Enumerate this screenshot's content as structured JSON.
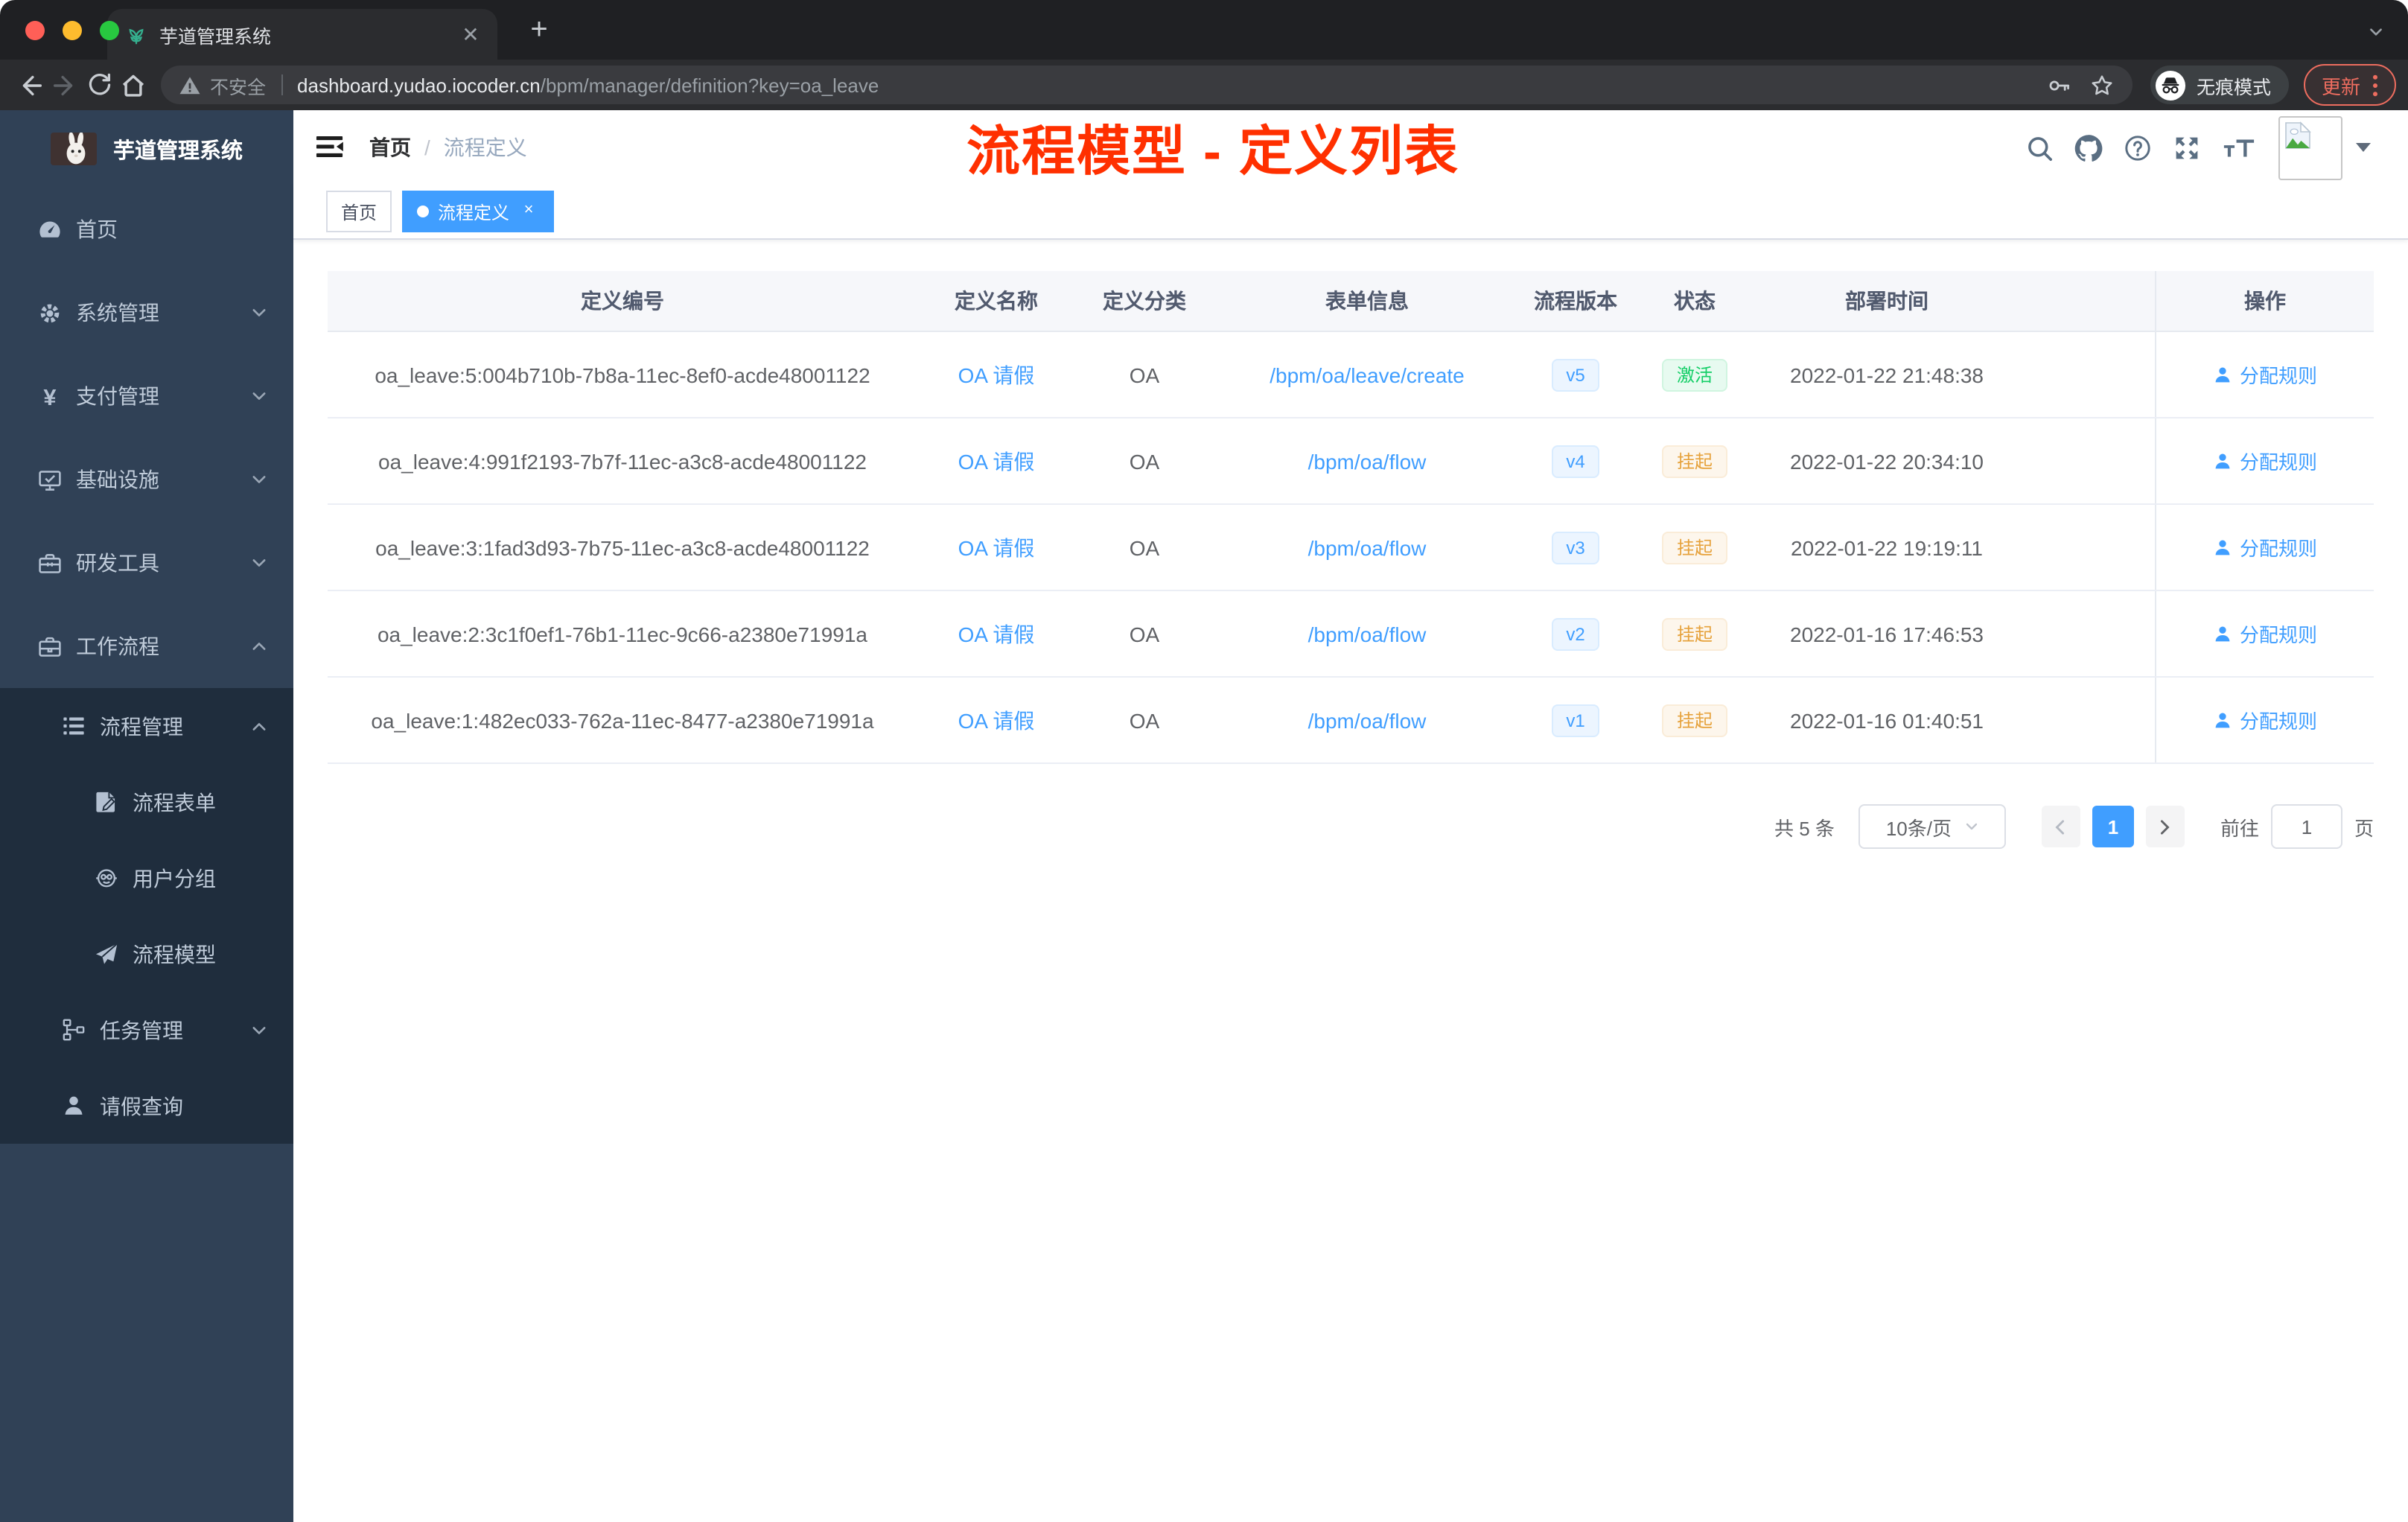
{
  "browser": {
    "window_controls": [
      "close",
      "minimize",
      "zoom"
    ],
    "tab": {
      "favicon": "plant-icon",
      "title": "芋道管理系统",
      "close_glyph": "✕",
      "new_tab_glyph": "+"
    },
    "address": {
      "security_label": "不安全",
      "url_host": "dashboard.yudao.iocoder.cn",
      "url_path": "/bpm/manager/definition?key=oa_leave"
    },
    "incognito_label": "无痕模式",
    "update_label": "更新"
  },
  "sidebar": {
    "app_title": "芋道管理系统",
    "menu": [
      {
        "key": "home",
        "label": "首页",
        "icon": "dashboard-icon",
        "level": 1
      },
      {
        "key": "system",
        "label": "系统管理",
        "icon": "gear-icon",
        "level": 1,
        "chevron": "down"
      },
      {
        "key": "payment",
        "label": "支付管理",
        "icon": "yen-icon",
        "level": 1,
        "chevron": "down"
      },
      {
        "key": "infra",
        "label": "基础设施",
        "icon": "monitor-icon",
        "level": 1,
        "chevron": "down"
      },
      {
        "key": "devtools",
        "label": "研发工具",
        "icon": "toolbox-icon",
        "level": 1,
        "chevron": "down"
      },
      {
        "key": "workflow",
        "label": "工作流程",
        "icon": "briefcase-icon",
        "level": 1,
        "chevron": "up"
      },
      {
        "key": "process-mgmt",
        "label": "流程管理",
        "icon": "list-icon",
        "level": 2,
        "chevron": "up"
      },
      {
        "key": "process-form",
        "label": "流程表单",
        "icon": "form-icon",
        "level": 3
      },
      {
        "key": "user-group",
        "label": "用户分组",
        "icon": "robot-icon",
        "level": 3
      },
      {
        "key": "process-model",
        "label": "流程模型",
        "icon": "paper-plane-icon",
        "level": 3
      },
      {
        "key": "task-mgmt",
        "label": "任务管理",
        "icon": "tree-icon",
        "level": 2,
        "chevron": "down"
      },
      {
        "key": "leave-query",
        "label": "请假查询",
        "icon": "user-icon",
        "level": 2
      }
    ]
  },
  "navbar": {
    "breadcrumb": {
      "home": "首页",
      "separator": "/",
      "current": "流程定义"
    },
    "annotation": {
      "text": "流程模型 - 定义列表",
      "color": "#ff3000"
    },
    "icons": [
      "search-icon",
      "github-icon",
      "help-icon",
      "fullscreen-icon",
      "font-size-icon",
      "avatar-broken-image",
      "caret-down-icon"
    ]
  },
  "tags_view": [
    {
      "label": "首页",
      "active": false,
      "closable": false
    },
    {
      "label": "流程定义",
      "active": true,
      "closable": true,
      "close_glyph": "×"
    }
  ],
  "table": {
    "columns": [
      "定义编号",
      "定义名称",
      "定义分类",
      "表单信息",
      "流程版本",
      "状态",
      "部署时间",
      "操作"
    ],
    "rows": [
      {
        "id": "oa_leave:5:004b710b-7b8a-11ec-8ef0-acde48001122",
        "name": "OA 请假",
        "category": "OA",
        "form": "/bpm/oa/leave/create",
        "version": "v5",
        "status": "激活",
        "status_type": "success",
        "deploy_time": "2022-01-22 21:48:38",
        "action": "分配规则"
      },
      {
        "id": "oa_leave:4:991f2193-7b7f-11ec-a3c8-acde48001122",
        "name": "OA 请假",
        "category": "OA",
        "form": "/bpm/oa/flow",
        "version": "v4",
        "status": "挂起",
        "status_type": "warning",
        "deploy_time": "2022-01-22 20:34:10",
        "action": "分配规则"
      },
      {
        "id": "oa_leave:3:1fad3d93-7b75-11ec-a3c8-acde48001122",
        "name": "OA 请假",
        "category": "OA",
        "form": "/bpm/oa/flow",
        "version": "v3",
        "status": "挂起",
        "status_type": "warning",
        "deploy_time": "2022-01-22 19:19:11",
        "action": "分配规则"
      },
      {
        "id": "oa_leave:2:3c1f0ef1-76b1-11ec-9c66-a2380e71991a",
        "name": "OA 请假",
        "category": "OA",
        "form": "/bpm/oa/flow",
        "version": "v2",
        "status": "挂起",
        "status_type": "warning",
        "deploy_time": "2022-01-16 17:46:53",
        "action": "分配规则"
      },
      {
        "id": "oa_leave:1:482ec033-762a-11ec-8477-a2380e71991a",
        "name": "OA 请假",
        "category": "OA",
        "form": "/bpm/oa/flow",
        "version": "v1",
        "status": "挂起",
        "status_type": "warning",
        "deploy_time": "2022-01-16 01:40:51",
        "action": "分配规则"
      }
    ]
  },
  "pagination": {
    "total_label": "共 5 条",
    "page_size_label": "10条/页",
    "current_page": "1",
    "goto_label": "前往",
    "goto_value": "1",
    "goto_suffix": "页"
  },
  "colors": {
    "accent_blue": "#409eff",
    "success_green": "#13ce66",
    "warning_orange": "#e6a23c",
    "annotation_red": "#ff3000",
    "sidebar_bg": "#304156",
    "submenu_bg": "#1f2d3d"
  }
}
